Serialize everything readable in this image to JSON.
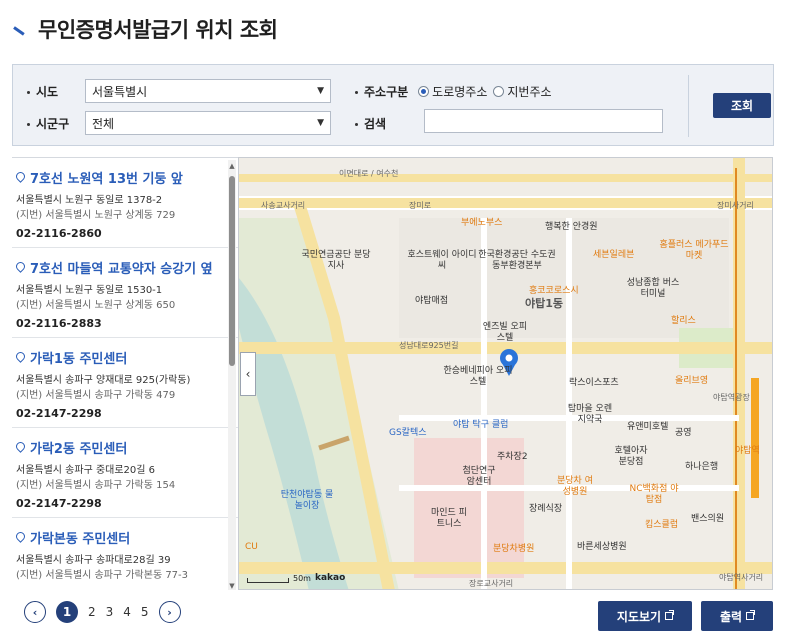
{
  "page": {
    "title": "무인증명서발급기 위치 조회"
  },
  "filters": {
    "sido_label": "시도",
    "sido_value": "서울특별시",
    "sigungu_label": "시군구",
    "sigungu_value": "전체",
    "addr_type_label": "주소구분",
    "addr_type_options": [
      "도로명주소",
      "지번주소"
    ],
    "addr_type_selected": "도로명주소",
    "search_label": "검색",
    "search_value": "",
    "search_button": "조회"
  },
  "results": [
    {
      "name": "7호선 노원역 13번 기둥 앞",
      "road_addr": "서울특별시 노원구 동일로 1378-2",
      "jibun_addr": "(지번) 서울특별시 노원구 상계동 729",
      "tel": "02-2116-2860"
    },
    {
      "name": "7호선 마들역 교통약자 승강기 옆",
      "road_addr": "서울특별시 노원구 동일로 1530-1",
      "jibun_addr": "(지번) 서울특별시 노원구 상계동 650",
      "tel": "02-2116-2883"
    },
    {
      "name": "가락1동 주민센터",
      "road_addr": "서울특별시 송파구 양재대로 925(가락동)",
      "jibun_addr": "(지번) 서울특별시 송파구 가락동 479",
      "tel": "02-2147-2298"
    },
    {
      "name": "가락2동 주민센터",
      "road_addr": "서울특별시 송파구 중대로20길 6",
      "jibun_addr": "(지번) 서울특별시 송파구 가락동 154",
      "tel": "02-2147-2298"
    },
    {
      "name": "가락본동 주민센터",
      "road_addr": "서울특별시 송파구 송파대로28길 39",
      "jibun_addr": "(지번) 서울특별시 송파구 가락본동 77-3",
      "tel": ""
    }
  ],
  "map": {
    "labels": {
      "road1": "이면대로 / 여수천",
      "road2": "사송교사거리",
      "road3": "장미로",
      "road4": "장미사거리",
      "place1": "부에노부스",
      "place2": "행복한 안경원",
      "place3": "국민연금공단 분당지사",
      "place4": "호스트웨이 아이디씨",
      "place5": "한국환경공단 수도권동부환경본부",
      "place6": "세븐일레븐",
      "place7": "홈플러스 메가푸드마켓",
      "place8": "홍코코로스시",
      "place9": "야탑1동",
      "place10": "성남종합 버스터미널",
      "place11": "야탑매점",
      "place12": "엔즈빌 오피스텔",
      "place13": "할리스",
      "place14": "성남대로925번길",
      "place15": "한승베네피아 오피스텔",
      "place16": "락스이스포츠",
      "place17": "올리브영",
      "place18": "야탑역광장",
      "place19": "GS칼텍스",
      "place20": "야탑 탁구 클럽",
      "place21": "탑마을 오렌지약국",
      "place22": "유앤미호텔",
      "place23": "공영",
      "place24": "주차장2",
      "place25": "호텔아자 분당점",
      "place26": "하나은행",
      "place27": "첨단연구 암센터",
      "place28": "분당차 여성병원",
      "place29": "NC백화점 야탑점",
      "place30": "탄천야탑동 물놀이장",
      "place31": "장례식장",
      "place32": "킴스클럽",
      "place33": "마인드 피트니스",
      "place34": "밴스의원",
      "place35": "분당차병원",
      "place36": "바른세상병원",
      "place37": "야탑역사거리",
      "place38": "CU",
      "place39": "장로교사거리",
      "place40": "야탑역",
      "scale": "50m",
      "brand": "kakao"
    }
  },
  "pagination": {
    "pages": [
      "1",
      "2",
      "3",
      "4",
      "5"
    ],
    "current": "1",
    "prev": "‹",
    "next": "›"
  },
  "actions": {
    "map_view": "지도보기",
    "print": "출력"
  }
}
